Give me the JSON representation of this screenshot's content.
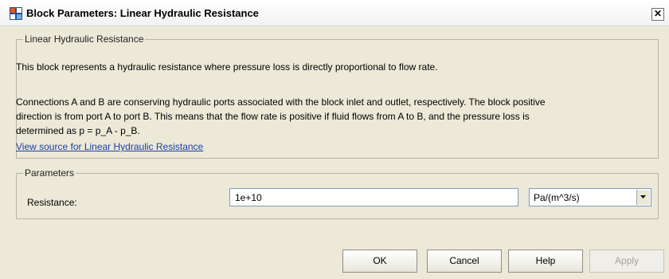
{
  "window": {
    "title": "Block Parameters: Linear Hydraulic Resistance",
    "close_glyph": "✕",
    "icon": "simulink-block-icon",
    "close_icon": "close-icon"
  },
  "description_group": {
    "legend": "Linear Hydraulic Resistance",
    "paragraph1": "This block represents a hydraulic resistance where pressure loss is directly proportional to flow rate.",
    "paragraph2_line1": "Connections A and B are conserving hydraulic ports associated with the block inlet and outlet, respectively. The block positive",
    "paragraph2_line2": "direction is from port A to port B. This means that the flow rate is positive if fluid flows from A to B, and the pressure loss is",
    "paragraph2_line3": "determined as p = p_A - p_B.",
    "link": "View source for Linear Hydraulic Resistance"
  },
  "parameters_group": {
    "legend": "Parameters",
    "resistance_label": "Resistance:",
    "resistance_value": "1e+10",
    "unit_selected": "Pa/(m^3/s)"
  },
  "buttons": {
    "ok": "OK",
    "cancel": "Cancel",
    "help": "Help",
    "apply": "Apply"
  },
  "colors": {
    "background": "#ece9d8",
    "link": "#1d3ea6",
    "disabled_text": "#a6a59c"
  }
}
